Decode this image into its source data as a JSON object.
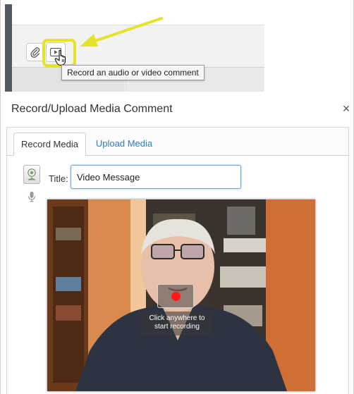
{
  "editor_toolbar": {
    "attach_icon": "paperclip-icon",
    "media_icon": "video-play-icon",
    "media_tooltip": "Record an audio or video comment",
    "pointer_icon": "hand-cursor-icon",
    "annotation_arrow_color": "#e6e22a"
  },
  "dialog": {
    "title": "Record/Upload Media Comment",
    "close_label": "×",
    "tabs": [
      {
        "label": "Record Media",
        "active": true
      },
      {
        "label": "Upload Media",
        "active": false
      }
    ],
    "webcam_icon": "webcam-icon",
    "mic_icon": "microphone-icon",
    "title_label": "Title:",
    "title_value": "Video Message",
    "record_hint": "Click anywhere to\nstart recording",
    "record_color": "#ff1a1a",
    "link_color": "#2b7ccb"
  }
}
